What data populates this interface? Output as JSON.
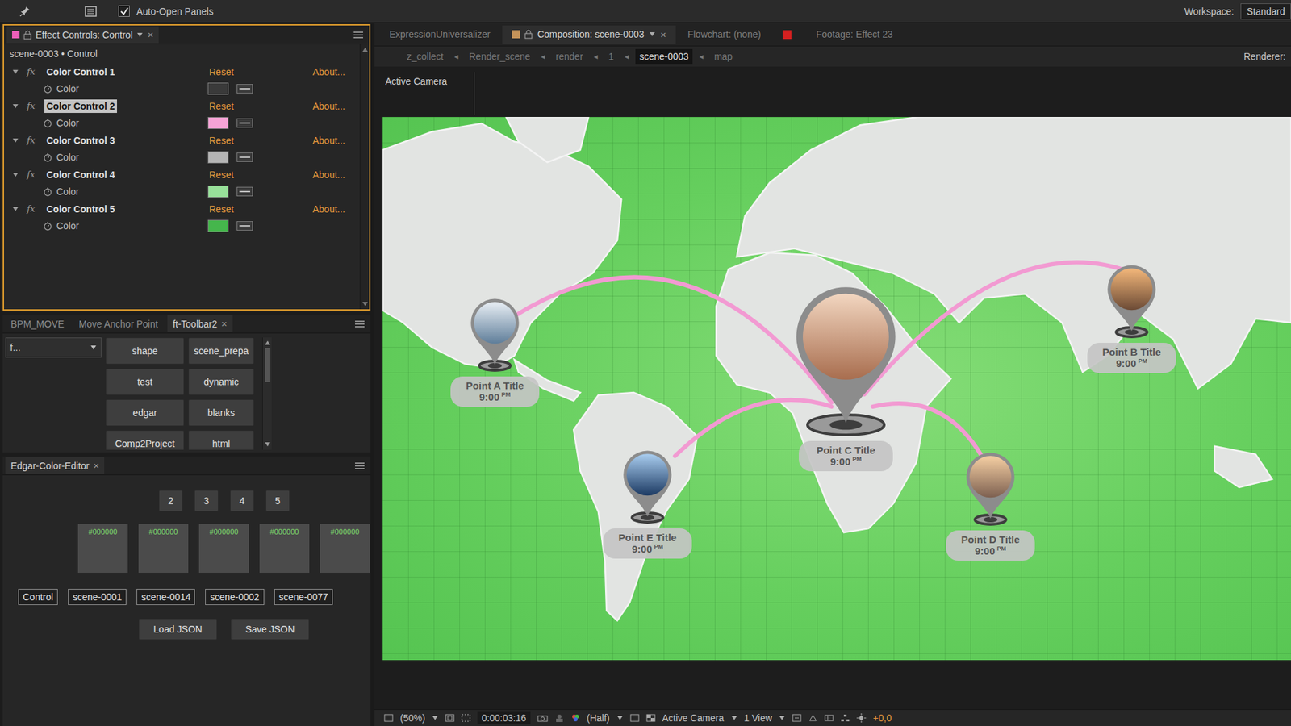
{
  "toolbar": {
    "auto_open": {
      "label": "Auto-Open Panels",
      "checked": true
    },
    "workspace_label": "Workspace:",
    "workspace": "Standard"
  },
  "effect_controls": {
    "tab": "Effect Controls: Control",
    "close": "×",
    "subtitle": "scene-0003 • Control",
    "fx_label": "fx",
    "reset_label": "Reset",
    "about_label": "About...",
    "effects": [
      {
        "name": "Color Control 1",
        "param": "Color",
        "color": "#3a3a3a",
        "selected": false,
        "expanded": true
      },
      {
        "name": "Color Control 2",
        "param": "Color",
        "color": "#f5a3d6",
        "selected": true,
        "expanded": true
      },
      {
        "name": "Color Control 3",
        "param": "Color",
        "color": "#b4b4b4",
        "selected": false,
        "expanded": true
      },
      {
        "name": "Color Control 4",
        "param": "Color",
        "color": "#98e09a",
        "selected": false,
        "expanded": true
      },
      {
        "name": "Color Control 5",
        "param": "Color",
        "color": "#45b64c",
        "selected": false,
        "expanded": true
      }
    ]
  },
  "toolbar_panel": {
    "tabs": [
      {
        "label": "BPM_MOVE",
        "selected": false,
        "close": false
      },
      {
        "label": "Move Anchor Point",
        "selected": false,
        "close": false
      },
      {
        "label": "ft-Toolbar2",
        "selected": true,
        "close": true
      }
    ],
    "close_glyph": "×",
    "dropdown": "f...",
    "buttons": [
      "shape",
      "scene_prepa",
      "test",
      "dynamic",
      "edgar",
      "blanks",
      "Comp2Project",
      "html"
    ]
  },
  "color_editor": {
    "tab": "Edgar-Color-Editor",
    "close": "×",
    "numbers": [
      "2",
      "3",
      "4",
      "5"
    ],
    "swatches": [
      "#000000",
      "#000000",
      "#000000",
      "#000000",
      "#000000"
    ],
    "labels": [
      "Control",
      "scene-0001",
      "scene-0014",
      "scene-0002",
      "scene-0077"
    ],
    "buttons": [
      "Load JSON",
      "Save JSON"
    ]
  },
  "viewer": {
    "tabs": [
      {
        "label": "ExpressionUniversalizer",
        "kind": "panel",
        "selected": false,
        "close": false
      },
      {
        "label": "Composition: scene-0003",
        "kind": "composition",
        "selected": true,
        "close": true
      },
      {
        "label": "Flowchart: (none)",
        "kind": "panel",
        "selected": false,
        "close": false
      },
      {
        "label": "Footage: Effect 23",
        "kind": "footage",
        "selected": false,
        "close": false
      }
    ],
    "close_glyph": "×",
    "breadcrumbs": [
      {
        "label": "z_collect",
        "selected": false
      },
      {
        "label": "Render_scene",
        "selected": false
      },
      {
        "label": "render",
        "selected": false
      },
      {
        "label": "1",
        "selected": false
      },
      {
        "label": "scene-0003",
        "selected": true
      },
      {
        "label": "map",
        "selected": false
      }
    ],
    "separator": "◂",
    "renderer_label": "Renderer:",
    "view_label": "Active Camera",
    "points": [
      {
        "title": "Point A Title",
        "time": "9:00",
        "ampm": "PM",
        "kind": "small"
      },
      {
        "title": "Point B Title",
        "time": "9:00",
        "ampm": "PM",
        "kind": "small"
      },
      {
        "title": "Point C Title",
        "time": "9:00",
        "ampm": "PM",
        "kind": "large"
      },
      {
        "title": "Point D Title",
        "time": "9:00",
        "ampm": "PM",
        "kind": "small"
      },
      {
        "title": "Point E Title",
        "time": "9:00",
        "ampm": "PM",
        "kind": "small"
      }
    ],
    "status": {
      "zoom": "(50%)",
      "timecode": "0:00:03:16",
      "resolution": "(Half)",
      "camera": "Active Camera",
      "views": "1 View",
      "exposure": "+0,0"
    }
  }
}
